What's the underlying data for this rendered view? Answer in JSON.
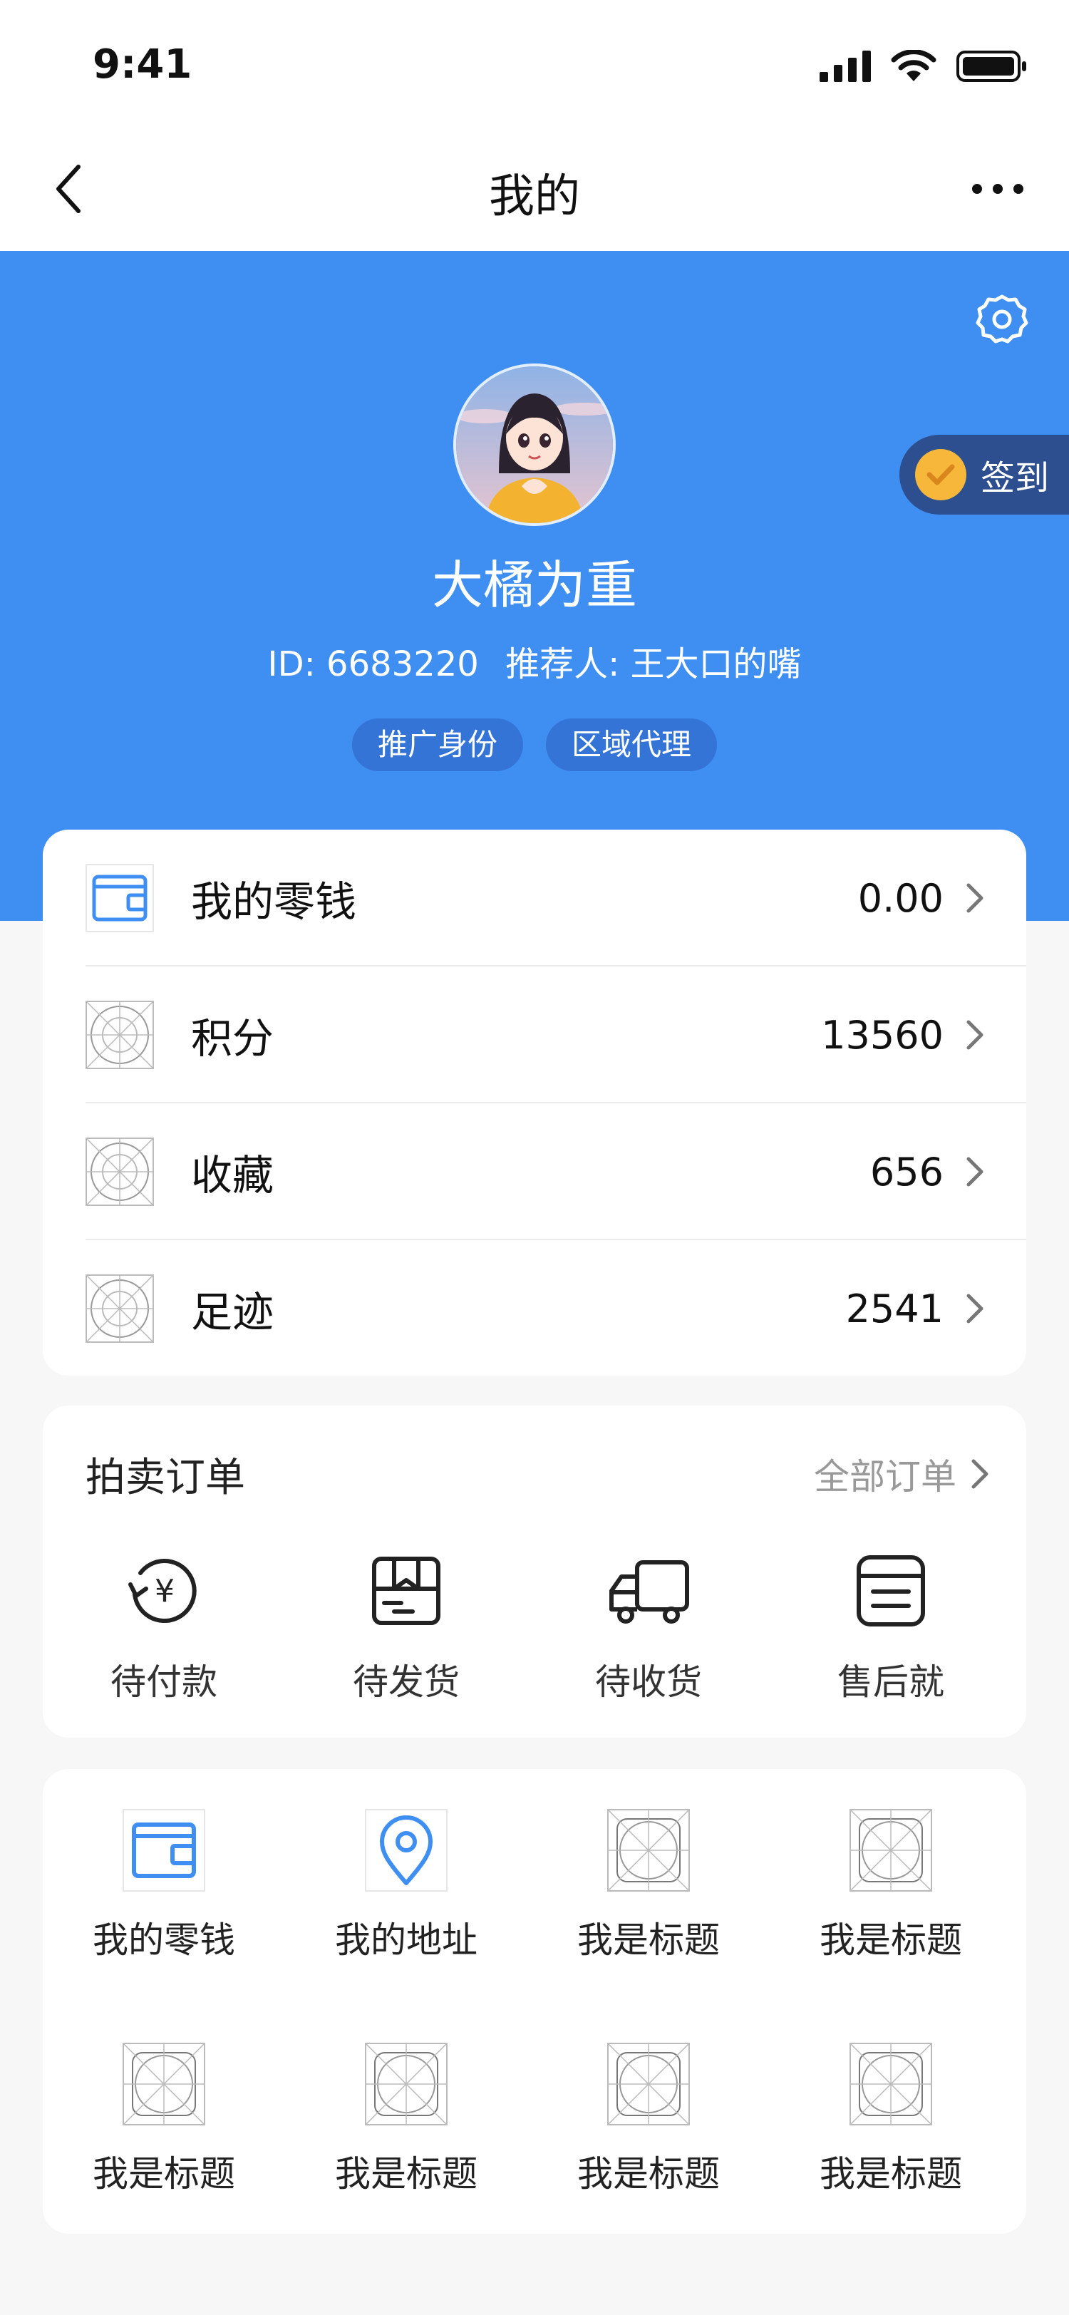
{
  "status": {
    "time": "9:41"
  },
  "nav": {
    "title": "我的"
  },
  "profile": {
    "name": "大橘为重",
    "id_label": "ID: 6683220",
    "referrer_label": "推荐人: 王大口的嘴",
    "tags": [
      "推广身份",
      "区域代理"
    ],
    "checkin_label": "签到"
  },
  "assets": [
    {
      "label": "我的零钱",
      "value": "0.00",
      "icon": "wallet-icon"
    },
    {
      "label": "积分",
      "value": "13560",
      "icon": "placeholder-icon"
    },
    {
      "label": "收藏",
      "value": "656",
      "icon": "placeholder-icon"
    },
    {
      "label": "足迹",
      "value": "2541",
      "icon": "placeholder-icon"
    }
  ],
  "orders": {
    "title": "拍卖订单",
    "all_label": "全部订单",
    "items": [
      {
        "label": "待付款",
        "icon": "pending-payment-icon"
      },
      {
        "label": "待发货",
        "icon": "pending-shipment-icon"
      },
      {
        "label": "待收货",
        "icon": "delivery-truck-icon"
      },
      {
        "label": "售后就",
        "icon": "after-sales-icon"
      }
    ]
  },
  "grid": [
    {
      "label": "我的零钱",
      "icon": "wallet-icon"
    },
    {
      "label": "我的地址",
      "icon": "location-pin-icon"
    },
    {
      "label": "我是标题",
      "icon": "placeholder-icon"
    },
    {
      "label": "我是标题",
      "icon": "placeholder-icon"
    },
    {
      "label": "我是标题",
      "icon": "placeholder-icon"
    },
    {
      "label": "我是标题",
      "icon": "placeholder-icon"
    },
    {
      "label": "我是标题",
      "icon": "placeholder-icon"
    },
    {
      "label": "我是标题",
      "icon": "placeholder-icon"
    }
  ],
  "colors": {
    "primary": "#3f8ff3",
    "checkin_bg": "#2d4e8f",
    "checkin_icon": "#f6b73a",
    "tag_bg": "#3374d6"
  }
}
